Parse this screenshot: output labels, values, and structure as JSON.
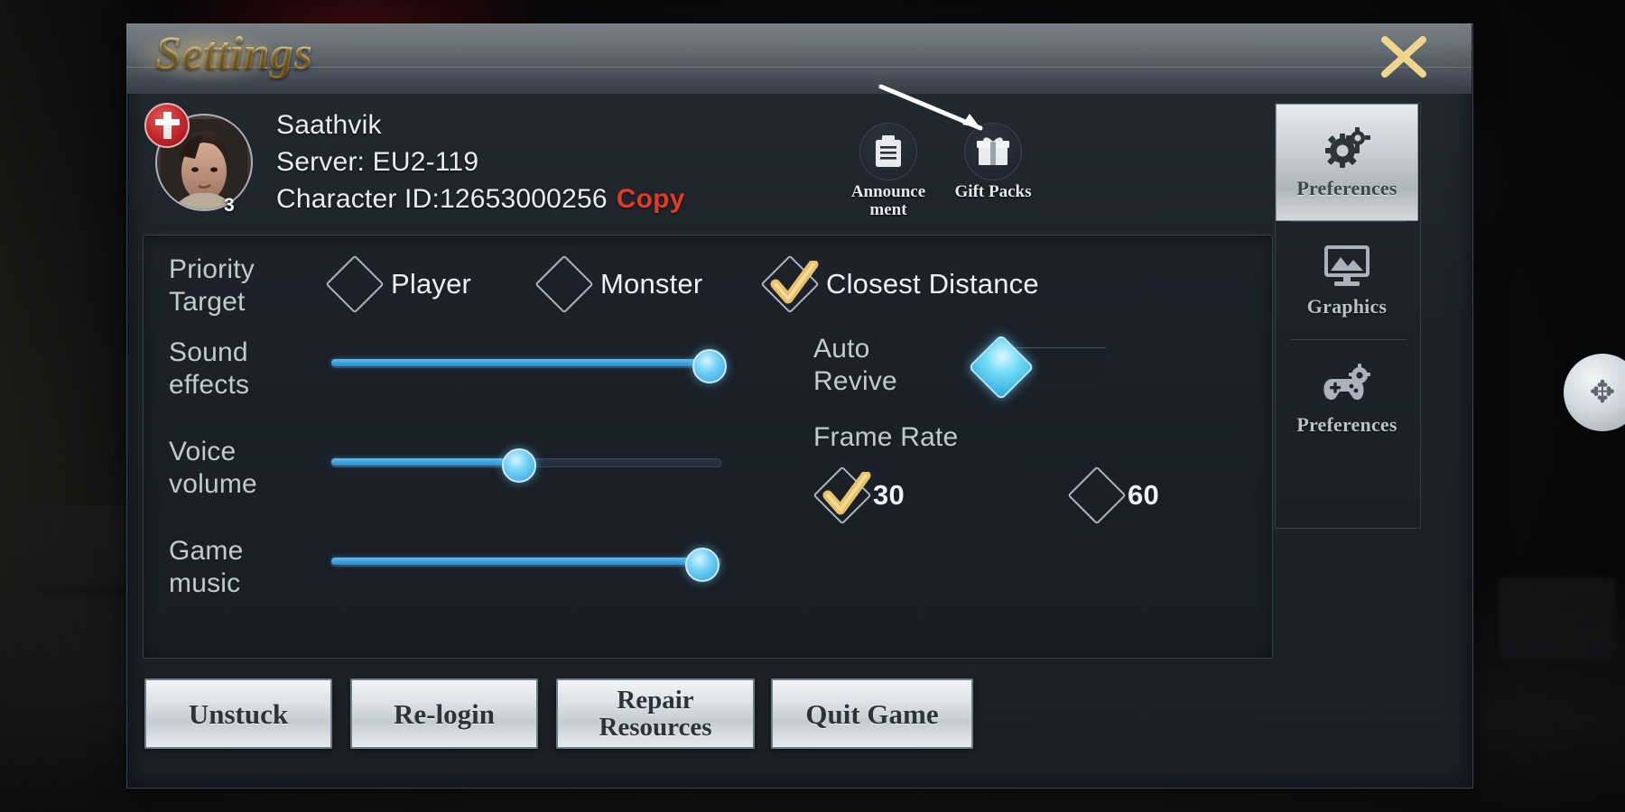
{
  "window": {
    "title": "Settings",
    "close_icon": "close-icon"
  },
  "profile": {
    "name": "Saathvik",
    "server": "Server: EU2-119",
    "character_id": "Character ID:12653000256",
    "copy_label": "Copy",
    "level": "3",
    "avatar_icon": "player-avatar",
    "guild_crest_icon": "guild-crest-icon"
  },
  "header_buttons": [
    {
      "label": "Announce\nment",
      "label_line1": "Announce",
      "label_line2": "ment",
      "icon": "announcement-icon"
    },
    {
      "label": "Gift Packs",
      "label_line1": "Gift Packs",
      "label_line2": "",
      "icon": "gift-box-icon"
    }
  ],
  "settings": {
    "priority_target": {
      "label_line1": "Priority",
      "label_line2": "Target",
      "options": [
        {
          "label": "Player",
          "selected": false
        },
        {
          "label": "Monster",
          "selected": false
        },
        {
          "label": "Closest Distance",
          "selected": true
        }
      ]
    },
    "sliders": [
      {
        "label_line1": "Sound",
        "label_line2": "effects",
        "value": 97
      },
      {
        "label_line1": "Voice",
        "label_line2": "volume",
        "value": 48
      },
      {
        "label_line1": "Game",
        "label_line2": "music",
        "value": 95
      }
    ],
    "auto_revive": {
      "label_line1": "Auto",
      "label_line2": "Revive",
      "enabled": true
    },
    "frame_rate": {
      "label": "Frame Rate",
      "options": [
        {
          "label": "30",
          "selected": true
        },
        {
          "label": "60",
          "selected": false
        }
      ]
    }
  },
  "tabs": [
    {
      "label": "Preferences",
      "icon": "gear-icon",
      "active": true
    },
    {
      "label": "Graphics",
      "icon": "monitor-icon",
      "active": false
    },
    {
      "label": "Preferences",
      "icon": "gamepad-icon",
      "active": false
    }
  ],
  "bottom_buttons": [
    {
      "label": "Unstuck",
      "line1": "Unstuck",
      "line2": ""
    },
    {
      "label": "Re-login",
      "line1": "Re-login",
      "line2": ""
    },
    {
      "label": "Repair Resources",
      "line1": "Repair",
      "line2": "Resources"
    },
    {
      "label": "Quit Game",
      "line1": "Quit Game",
      "line2": ""
    }
  ],
  "hud": {
    "joystick_icon": "move-joystick-icon"
  },
  "colors": {
    "title_gold": "#f2d98c",
    "copy_red": "#e03b24",
    "slider_blue": "#3a9fe0",
    "check_gold": "#e8c267",
    "panel_bg": "#1c212a"
  }
}
